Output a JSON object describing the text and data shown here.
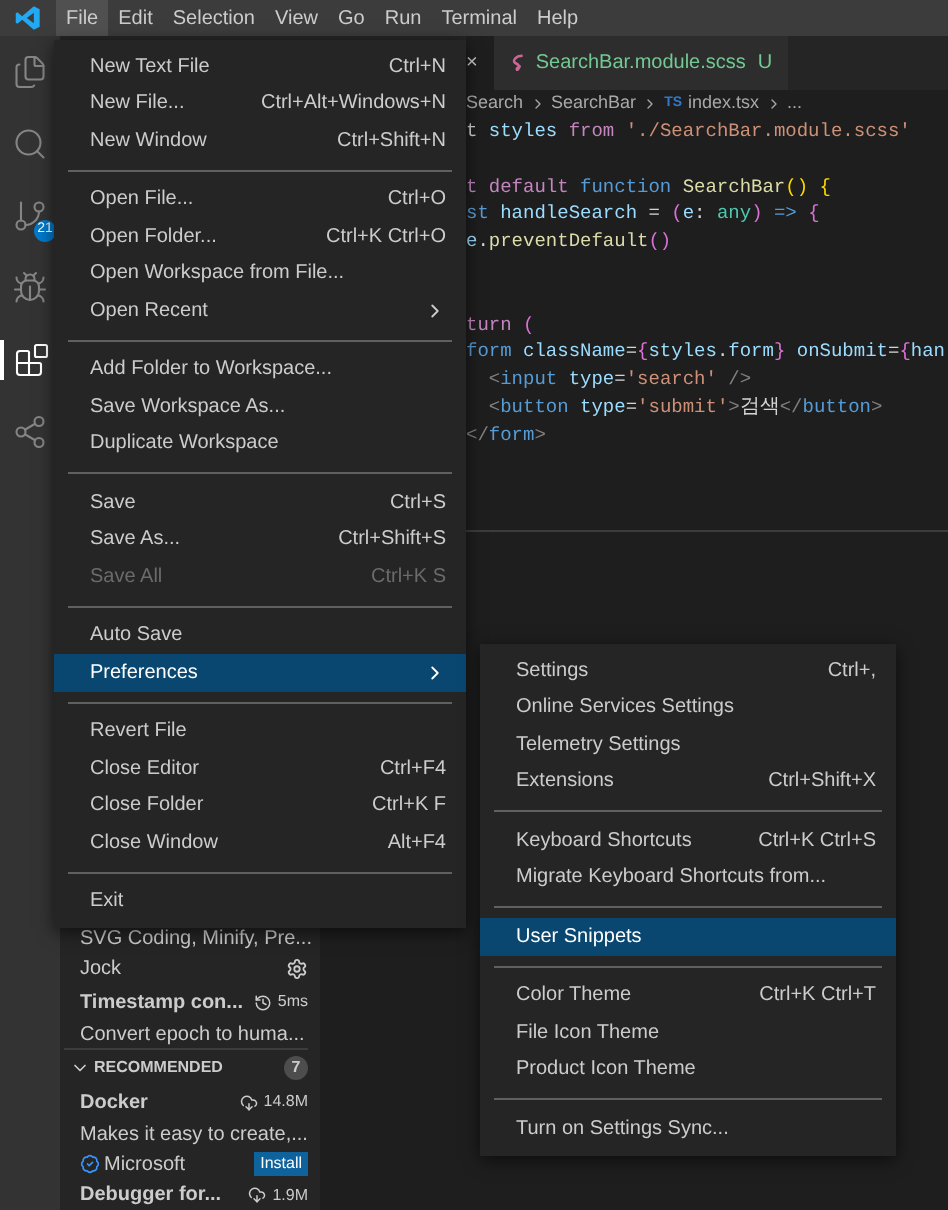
{
  "menubar": [
    {
      "label": "File",
      "selected": true
    },
    {
      "label": "Edit",
      "selected": false
    },
    {
      "label": "Selection",
      "selected": false
    },
    {
      "label": "View",
      "selected": false
    },
    {
      "label": "Go",
      "selected": false
    },
    {
      "label": "Run",
      "selected": false
    },
    {
      "label": "Terminal",
      "selected": false
    },
    {
      "label": "Help",
      "selected": false
    }
  ],
  "activity_bar": [
    {
      "kind": "files",
      "selected": false
    },
    {
      "kind": "search",
      "selected": false
    },
    {
      "kind": "source-control",
      "selected": false,
      "badge": "21"
    },
    {
      "kind": "run",
      "selected": false
    },
    {
      "kind": "extensions",
      "selected": true
    },
    {
      "kind": "remote",
      "selected": false
    }
  ],
  "tabs": [
    {
      "close": "×"
    },
    {
      "label": "SearchBar.module.scss",
      "status": "U"
    }
  ],
  "breadcrumb": [
    "Search",
    "SearchBar",
    "index.tsx",
    "..."
  ],
  "breadcrumb_file_badge": "TS",
  "code": [
    [
      {
        "kind": "plain",
        "text": "t "
      },
      {
        "kind": "var",
        "text": "styles "
      },
      {
        "kind": "kw",
        "text": "from "
      },
      {
        "kind": "str",
        "text": "'./SearchBar.module.scss'"
      }
    ],
    [
      {
        "kind": "blank"
      }
    ],
    [
      {
        "kind": "kw",
        "text": "t default "
      },
      {
        "kind": "decl",
        "text": "function "
      },
      {
        "kind": "fn",
        "text": "SearchBar"
      },
      {
        "kind": "brace",
        "text": "() {"
      }
    ],
    [
      {
        "kind": "decl",
        "text": "st "
      },
      {
        "kind": "var",
        "text": "handleSearch "
      },
      {
        "kind": "plain",
        "text": "= "
      },
      {
        "kind": "paren",
        "text": "("
      },
      {
        "kind": "var",
        "text": "e"
      },
      {
        "kind": "plain",
        "text": ": "
      },
      {
        "kind": "type",
        "text": "any"
      },
      {
        "kind": "paren",
        "text": ") "
      },
      {
        "kind": "decl",
        "text": "=> "
      },
      {
        "kind": "paren",
        "text": "{"
      }
    ],
    [
      {
        "kind": "var",
        "text": "e"
      },
      {
        "kind": "plain",
        "text": "."
      },
      {
        "kind": "fn",
        "text": "preventDefault"
      },
      {
        "kind": "paren",
        "text": "()"
      }
    ],
    [
      {
        "kind": "blank"
      }
    ],
    [
      {
        "kind": "blank"
      }
    ],
    [
      {
        "kind": "kw",
        "text": "turn "
      },
      {
        "kind": "paren",
        "text": "("
      }
    ],
    [
      {
        "kind": "tag",
        "text": "form "
      },
      {
        "kind": "var",
        "text": "className"
      },
      {
        "kind": "plain",
        "text": "="
      },
      {
        "kind": "paren",
        "text": "{"
      },
      {
        "kind": "var",
        "text": "styles"
      },
      {
        "kind": "plain",
        "text": "."
      },
      {
        "kind": "var",
        "text": "form"
      },
      {
        "kind": "paren",
        "text": "} "
      },
      {
        "kind": "var",
        "text": "onSubmit"
      },
      {
        "kind": "plain",
        "text": "="
      },
      {
        "kind": "paren",
        "text": "{"
      },
      {
        "kind": "var",
        "text": "han"
      }
    ],
    [
      {
        "kind": "punct",
        "text": "  <"
      },
      {
        "kind": "tag",
        "text": "input "
      },
      {
        "kind": "var",
        "text": "type"
      },
      {
        "kind": "plain",
        "text": "="
      },
      {
        "kind": "str",
        "text": "'search' "
      },
      {
        "kind": "punct",
        "text": "/>"
      }
    ],
    [
      {
        "kind": "punct",
        "text": "  <"
      },
      {
        "kind": "tag",
        "text": "button "
      },
      {
        "kind": "var",
        "text": "type"
      },
      {
        "kind": "plain",
        "text": "="
      },
      {
        "kind": "str",
        "text": "'submit'"
      },
      {
        "kind": "punct",
        "text": ">"
      },
      {
        "kind": "plain",
        "text": "검색"
      },
      {
        "kind": "punct",
        "text": "</"
      },
      {
        "kind": "tag",
        "text": "button"
      },
      {
        "kind": "punct",
        "text": ">"
      }
    ],
    [
      {
        "kind": "punct",
        "text": "</"
      },
      {
        "kind": "tag",
        "text": "form"
      },
      {
        "kind": "punct",
        "text": ">"
      }
    ]
  ],
  "extensions": [
    {
      "kind": "desc",
      "text": "SVG Coding, Minify, Pre..."
    },
    {
      "kind": "publisher",
      "text": "Jock"
    },
    {
      "kind": "title",
      "text": "Timestamp con...",
      "meta": "5ms"
    },
    {
      "kind": "desc",
      "text": "Convert epoch to huma..."
    },
    {
      "kind": "section",
      "text": "RECOMMENDED",
      "count": "7",
      "expanded": true
    },
    {
      "kind": "title",
      "text": "Docker",
      "meta": "14.8M"
    },
    {
      "kind": "desc",
      "text": "Makes it easy to create,..."
    },
    {
      "kind": "install",
      "text": "Microsoft",
      "button": "Install"
    },
    {
      "kind": "title",
      "text": "Debugger for...",
      "meta": "1.9M"
    }
  ],
  "file_menu": [
    [
      {
        "label": "New Text File",
        "shortcut": "Ctrl+N",
        "disabled": false,
        "selected": false
      },
      {
        "label": "New File...",
        "shortcut": "Ctrl+Alt+Windows+N",
        "disabled": false,
        "selected": false
      },
      {
        "label": "New Window",
        "shortcut": "Ctrl+Shift+N",
        "disabled": false,
        "selected": false
      }
    ],
    [
      {
        "label": "Open File...",
        "shortcut": "Ctrl+O",
        "disabled": false,
        "selected": false
      },
      {
        "label": "Open Folder...",
        "shortcut": "Ctrl+K Ctrl+O",
        "disabled": false,
        "selected": false
      },
      {
        "label": "Open Workspace from File...",
        "disabled": false,
        "selected": false
      },
      {
        "label": "Open Recent",
        "submenu": true,
        "disabled": false,
        "selected": false
      }
    ],
    [
      {
        "label": "Add Folder to Workspace...",
        "disabled": false,
        "selected": false
      },
      {
        "label": "Save Workspace As...",
        "disabled": false,
        "selected": false
      },
      {
        "label": "Duplicate Workspace",
        "disabled": false,
        "selected": false
      }
    ],
    [
      {
        "label": "Save",
        "shortcut": "Ctrl+S",
        "disabled": false,
        "selected": false
      },
      {
        "label": "Save As...",
        "shortcut": "Ctrl+Shift+S",
        "disabled": false,
        "selected": false
      },
      {
        "label": "Save All",
        "shortcut": "Ctrl+K S",
        "disabled": true,
        "selected": false
      }
    ],
    [
      {
        "label": "Auto Save",
        "disabled": false,
        "selected": false
      },
      {
        "label": "Preferences",
        "submenu": true,
        "disabled": false,
        "selected": true
      }
    ],
    [
      {
        "label": "Revert File",
        "disabled": false,
        "selected": false
      },
      {
        "label": "Close Editor",
        "shortcut": "Ctrl+F4",
        "disabled": false,
        "selected": false
      },
      {
        "label": "Close Folder",
        "shortcut": "Ctrl+K F",
        "disabled": false,
        "selected": false
      },
      {
        "label": "Close Window",
        "shortcut": "Alt+F4",
        "disabled": false,
        "selected": false
      }
    ],
    [
      {
        "label": "Exit",
        "disabled": false,
        "selected": false
      }
    ]
  ],
  "preferences_menu": [
    [
      {
        "label": "Settings",
        "shortcut": "Ctrl+,",
        "selected": false
      },
      {
        "label": "Online Services Settings",
        "selected": false
      },
      {
        "label": "Telemetry Settings",
        "selected": false
      },
      {
        "label": "Extensions",
        "shortcut": "Ctrl+Shift+X",
        "selected": false
      }
    ],
    [
      {
        "label": "Keyboard Shortcuts",
        "shortcut": "Ctrl+K Ctrl+S",
        "selected": false
      },
      {
        "label": "Migrate Keyboard Shortcuts from...",
        "selected": false
      }
    ],
    [
      {
        "label": "User Snippets",
        "selected": true
      }
    ],
    [
      {
        "label": "Color Theme",
        "shortcut": "Ctrl+K Ctrl+T",
        "selected": false
      },
      {
        "label": "File Icon Theme",
        "selected": false
      },
      {
        "label": "Product Icon Theme",
        "selected": false
      }
    ],
    [
      {
        "label": "Turn on Settings Sync...",
        "selected": false
      }
    ]
  ]
}
